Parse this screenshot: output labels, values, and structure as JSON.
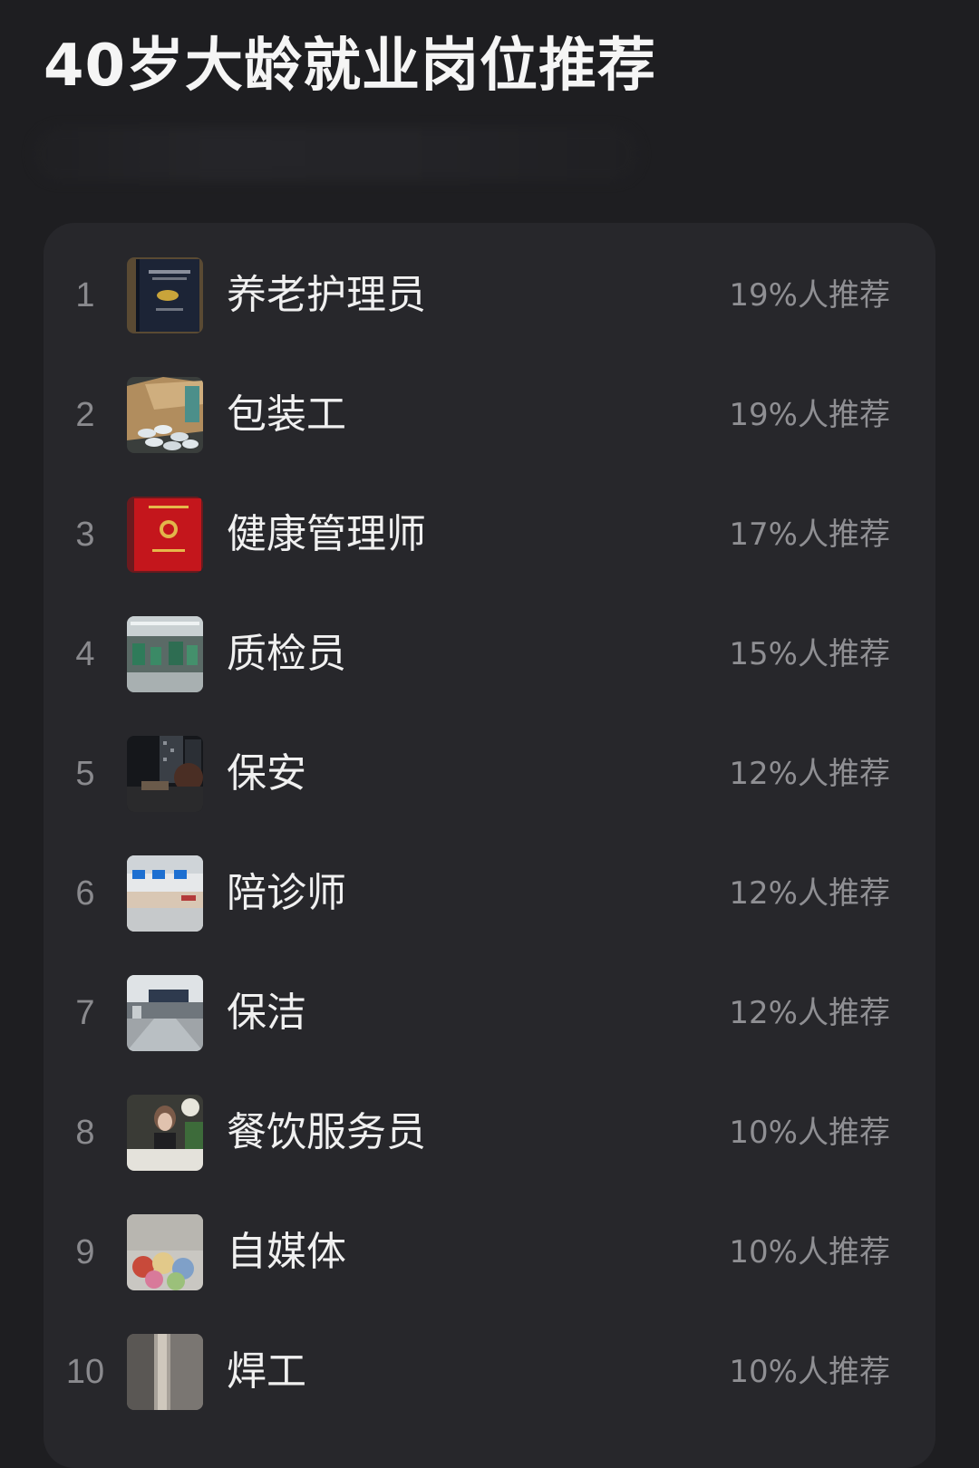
{
  "page": {
    "title": "40岁大龄就业岗位推荐"
  },
  "colors": {
    "background": "#1e1e21",
    "card": "#27272b",
    "title_text": "#f5f5f5",
    "muted_text": "#8f8f93"
  },
  "jobs": [
    {
      "rank": "1",
      "name": "养老护理员",
      "percent": "19%人推荐",
      "thumb": "certificate-booklet-image"
    },
    {
      "rank": "2",
      "name": "包装工",
      "percent": "19%人推荐",
      "thumb": "packing-box-image"
    },
    {
      "rank": "3",
      "name": "健康管理师",
      "percent": "17%人推荐",
      "thumb": "red-certificate-image"
    },
    {
      "rank": "4",
      "name": "质检员",
      "percent": "15%人推荐",
      "thumb": "factory-floor-image"
    },
    {
      "rank": "5",
      "name": "保安",
      "percent": "12%人推荐",
      "thumb": "night-building-image"
    },
    {
      "rank": "6",
      "name": "陪诊师",
      "percent": "12%人推荐",
      "thumb": "hospital-hall-image"
    },
    {
      "rank": "7",
      "name": "保洁",
      "percent": "12%人推荐",
      "thumb": "mall-floor-image"
    },
    {
      "rank": "8",
      "name": "餐饮服务员",
      "percent": "10%人推荐",
      "thumb": "restaurant-image"
    },
    {
      "rank": "9",
      "name": "自媒体",
      "percent": "10%人推荐",
      "thumb": "plush-toys-image"
    },
    {
      "rank": "10",
      "name": "焊工",
      "percent": "10%人推荐",
      "thumb": "weld-seam-image"
    }
  ]
}
